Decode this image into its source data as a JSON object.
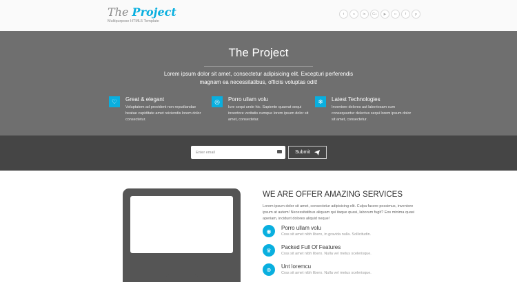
{
  "header": {
    "logo_word1": "The",
    "logo_word2": "Project",
    "tagline": "Multipurpose HTML5 Template",
    "social_icons": [
      {
        "name": "twitter-icon",
        "glyph": "t"
      },
      {
        "name": "skype-icon",
        "glyph": "s"
      },
      {
        "name": "linkedin-icon",
        "glyph": "in"
      },
      {
        "name": "googleplus-icon",
        "glyph": "G+"
      },
      {
        "name": "youtube-icon",
        "glyph": "▶"
      },
      {
        "name": "flickr-icon",
        "glyph": "••"
      },
      {
        "name": "facebook-icon",
        "glyph": "f"
      },
      {
        "name": "pinterest-icon",
        "glyph": "p"
      }
    ]
  },
  "hero": {
    "title": "The Project",
    "subtitle": "Lorem ipsum dolor sit amet, consectetur adipisicing elit. Excepturi perferendis magnam ea necessitatibus, officiis voluptas odit!",
    "features": [
      {
        "icon": "heart-icon",
        "glyph": "♡",
        "title": "Great & elegant",
        "text": "Voluptatem ad provident non repudiandae beatae cupiditate amet reiciendis lorem dolor consectetur."
      },
      {
        "icon": "life-ring-icon",
        "glyph": "◎",
        "title": "Porro ullam volu",
        "text": "Iure sequi unde hic. Sapiente quaerat sequi inventore veritatis cumque lorem ipsum dolor sit amet, consectetur."
      },
      {
        "icon": "snowflake-icon",
        "glyph": "❄",
        "title": "Latest Technologies",
        "text": "Inventore dolores aut laboriosam cum consequuntur delectus sequi lorem ipsum dolor sit amet, consectetur."
      }
    ]
  },
  "subscribe": {
    "placeholder": "Enter email",
    "button_label": "Submit"
  },
  "services": {
    "title": "WE ARE OFFER AMAZING SERVICES",
    "description": "Lorem ipsum dolor sit amet, consectetur adipisicing elit. Culpa facere possimus, inventore ipsum at autem! Necessitatibus aliquam qui itaque quasi, laborum fugit? Eos minima quasi aperiam, incidunt dolores aliquid neque!",
    "items": [
      {
        "icon": "eye-icon",
        "glyph": "◉",
        "title": "Porro ullam volu",
        "text": "Cras sit amet nibh libero, in gravida nulla. Sollicitudin."
      },
      {
        "icon": "trophy-icon",
        "glyph": "♛",
        "title": "Packed Full Of Features",
        "text": "Cras sit amet nibh libero. Nulla vel metus scelerisque."
      },
      {
        "icon": "life-ring-icon",
        "glyph": "⊕",
        "title": "Unt loremcu",
        "text": "Cras sit amet nibh libero. Nulla vel metus scelerisque."
      }
    ]
  },
  "colors": {
    "accent": "#09afdf",
    "hero_bg": "#6f6f6f",
    "subscribe_bg": "#454545",
    "monitor": "#555555"
  }
}
